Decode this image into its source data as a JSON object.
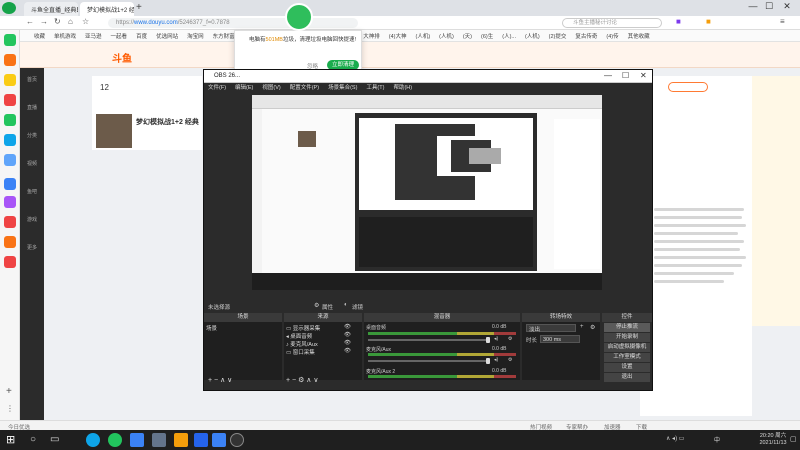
{
  "browser": {
    "tab1_title": "斗鱼全直播_经典即时直播_长",
    "tab2_title": "梦幻模拟战1+2 经典即时之...",
    "new_tab": "+",
    "url_scheme": "https://",
    "url_host": "www.douyu.com",
    "url_path": "/5246377_f=0.7878",
    "search_placeholder": "斗鱼主播秘计讨论",
    "bookmarks": [
      "收藏",
      "单机游戏",
      "亚马逊",
      "一起看",
      "百度",
      "优选网站",
      "淘宝网",
      "东方财富",
      "(2/3)",
      "(4)...",
      "(4)确",
      "月票斗鱼",
      "(4)问答",
      "大神排",
      "(4)大神",
      "(人机)",
      "(人机)",
      "(天)",
      "(6)生",
      "(人)...",
      "(人机)",
      "(2)提交",
      "复古传奇",
      "(4)传",
      "其他收藏"
    ]
  },
  "page": {
    "logo": "斗鱼",
    "rank_num": "12",
    "room_title": "梦幻模拟战1+2 经典",
    "leftnav": [
      "首页",
      "直播",
      "分类",
      "视频",
      "鱼吧",
      "游戏",
      "更多"
    ]
  },
  "notif": {
    "text_pre": "电脑有",
    "text_hl": "501MB",
    "text_post": "垃圾，清理垃圾电脑回快提速!",
    "close": "忽略",
    "action": "立即清理"
  },
  "obs": {
    "title": "OBS 26...",
    "menu": [
      "文件(F)",
      "编辑(E)",
      "视图(V)",
      "配置文件(P)",
      "场景集合(S)",
      "工具(T)",
      "帮助(H)"
    ],
    "no_source": "未选择源",
    "props_btn": "属性",
    "filter_btn": "滤镜",
    "docks": {
      "scenes": "场景",
      "sources": "来源",
      "mixer": "混音器",
      "transitions": "转场特效",
      "controls": "控件"
    },
    "scene_items": [
      "场景"
    ],
    "source_items": [
      "显示器采集",
      "桌面音频",
      "麦克风/Aux",
      "窗口采集"
    ],
    "mixer": [
      {
        "name": "桌面音频",
        "db": "0.0 dB"
      },
      {
        "name": "麦克风/Aux",
        "db": "0.0 dB"
      },
      {
        "name": "麦克风/Aux 2",
        "db": "0.0 dB"
      }
    ],
    "transition": "淡出",
    "duration_label": "时长",
    "duration_value": "300 ms",
    "controls": [
      "停止推流",
      "开始录制",
      "启动虚拟摄像机",
      "工作室模式",
      "设置",
      "退出"
    ],
    "dock_footer": "+ − ∧ ∨"
  },
  "statusbar": {
    "left": "今日优选",
    "items": [
      "热门视频",
      "专家帮办",
      "加速器",
      "下载"
    ]
  },
  "taskbar": {
    "time": "20:20 周六",
    "date": "2021/11/13",
    "lang": "中"
  },
  "colors": {
    "douyu_orange": "#ff5a00",
    "obs_bg": "#2b2b2b",
    "notif_green": "#1aac4d"
  }
}
